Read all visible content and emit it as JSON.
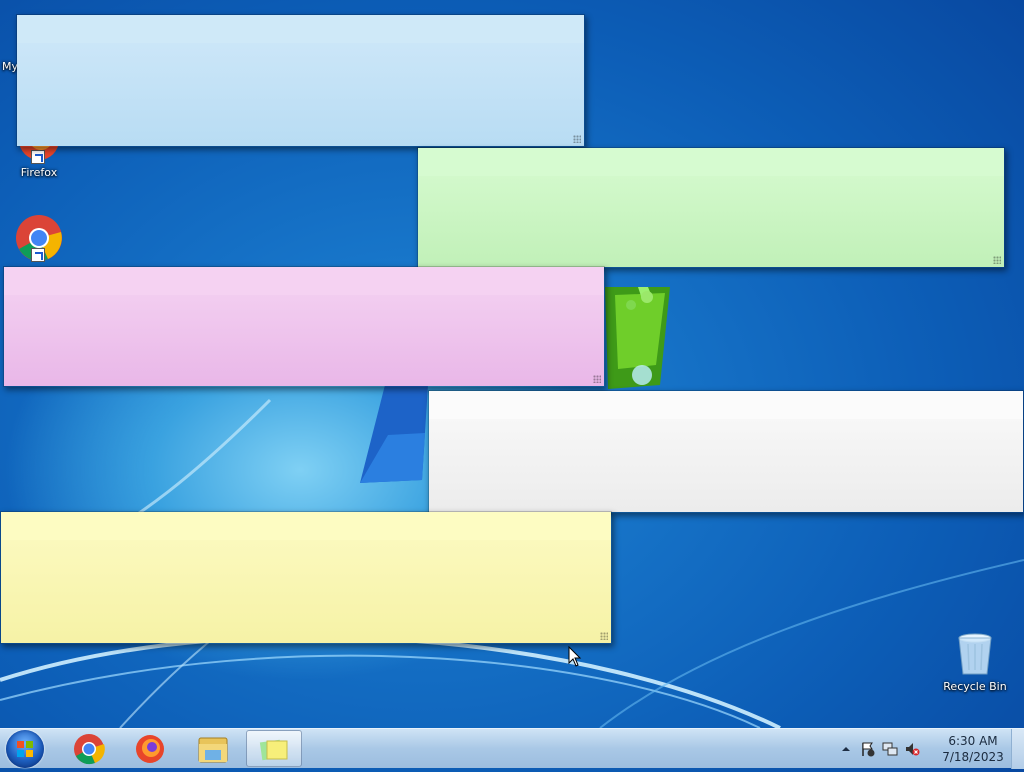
{
  "desktop": {
    "icons": [
      {
        "id": "my-computer",
        "label": "My"
      },
      {
        "id": "firefox",
        "label": "Firefox"
      },
      {
        "id": "chrome",
        "label": ""
      },
      {
        "id": "recycle-bin",
        "label": "Recycle Bin"
      }
    ]
  },
  "sticky_notes": [
    {
      "color": "blue",
      "bar": "#cfe9f8",
      "body": "#bfe0f5",
      "text": ""
    },
    {
      "color": "green",
      "bar": "#d6fbd0",
      "body": "#c9f5c1",
      "text": ""
    },
    {
      "color": "pink",
      "bar": "#f5d2f2",
      "body": "#eebdec",
      "text": ""
    },
    {
      "color": "white",
      "bar": "#fbfbfb",
      "body": "#f0f0f0",
      "text": ""
    },
    {
      "color": "yellow",
      "bar": "#fdfcc2",
      "body": "#f9f5b0",
      "text": ""
    }
  ],
  "taskbar": {
    "pinned": [
      "chrome-icon",
      "firefox-icon",
      "file-explorer-icon",
      "sticky-notes-icon"
    ],
    "active_app": "sticky-notes",
    "clock": {
      "time": "6:30 AM",
      "date": "7/18/2023"
    },
    "tray_icons": [
      "show-hidden-icons-arrow-icon",
      "action-center-flag-icon",
      "network-icon",
      "volume-muted-icon"
    ]
  }
}
